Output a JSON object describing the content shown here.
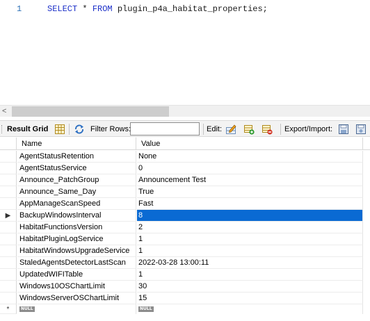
{
  "editor": {
    "line_number": "1",
    "kw_select": "SELECT",
    "star": " * ",
    "kw_from": "FROM",
    "table": " plugin_p4a_habitat_properties;"
  },
  "scrollbar": {
    "left_arrow": "<"
  },
  "toolbar": {
    "result_grid_label": "Result Grid",
    "filter_rows_label": "Filter Rows:",
    "filter_value": "",
    "edit_label": "Edit:",
    "export_import_label": "Export/Import:"
  },
  "grid": {
    "columns": [
      "Name",
      "Value"
    ],
    "rows": [
      {
        "name": "AgentStatusRetention",
        "value": "None"
      },
      {
        "name": "AgentStatusService",
        "value": "0"
      },
      {
        "name": "Announce_PatchGroup",
        "value": "Announcement Test"
      },
      {
        "name": "Announce_Same_Day",
        "value": "True"
      },
      {
        "name": "AppManageScanSpeed",
        "value": "Fast"
      },
      {
        "name": "BackupWindowsInterval",
        "value": "8"
      },
      {
        "name": "HabitatFunctionsVersion",
        "value": "2"
      },
      {
        "name": "HabitatPluginLogService",
        "value": "1"
      },
      {
        "name": "HabitatWindowsUpgradeService",
        "value": "1"
      },
      {
        "name": "StaledAgentsDetectorLastScan",
        "value": "2022-03-28 13:00:11"
      },
      {
        "name": "UpdatedWIFITable",
        "value": "1"
      },
      {
        "name": "Windows10OSChartLimit",
        "value": "30"
      },
      {
        "name": "WindowsServerOSChartLimit",
        "value": "15"
      }
    ],
    "selected_row_marker": "▶",
    "new_row_marker": "*",
    "null_label": "NULL"
  }
}
